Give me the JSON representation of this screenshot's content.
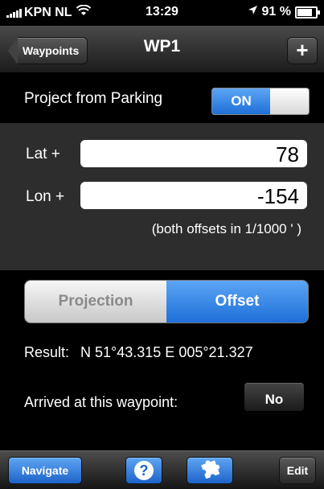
{
  "status_bar": {
    "carrier": "KPN NL",
    "time": "13:29",
    "battery": "91 %"
  },
  "nav": {
    "back_label": "Waypoints",
    "title": "WP1",
    "add_label": "+"
  },
  "project": {
    "label": "Project from Parking",
    "toggle_on": "ON"
  },
  "offsets": {
    "lat_label": "Lat +",
    "lat_value": "78",
    "lon_label": "Lon +",
    "lon_value": "-154",
    "hint": "(both offsets in 1/1000 ' )"
  },
  "segmented": {
    "projection": "Projection",
    "offset": "Offset",
    "selected": "Offset"
  },
  "result": {
    "label": "Result:",
    "value": "N 51°43.315 E 005°21.327"
  },
  "arrived": {
    "label": "Arrived at this waypoint:",
    "value": "No"
  },
  "toolbar": {
    "navigate": "Navigate",
    "help": "?",
    "edit": "Edit"
  },
  "colors": {
    "accent_blue": "#1e6fd8",
    "offset_section_bg": "#2d2d2d"
  }
}
